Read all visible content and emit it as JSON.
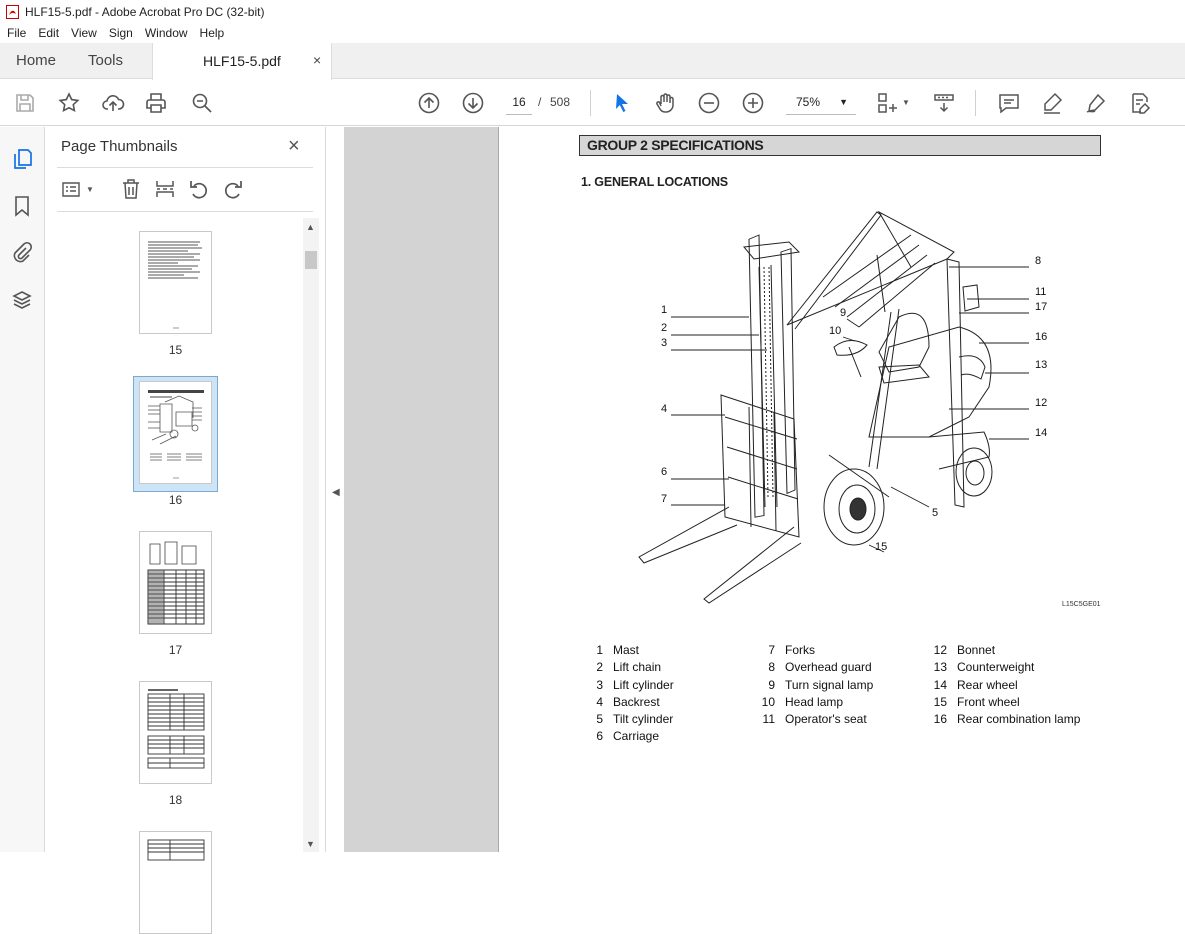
{
  "window": {
    "title": "HLF15-5.pdf - Adobe Acrobat Pro DC (32-bit)"
  },
  "menu": [
    "File",
    "Edit",
    "View",
    "Sign",
    "Window",
    "Help"
  ],
  "tabs": {
    "home": "Home",
    "tools": "Tools",
    "document": "HLF15-5.pdf",
    "close": "×"
  },
  "toolbar": {
    "current_page": "16",
    "separator": "/",
    "total_pages": "508",
    "zoom": "75%"
  },
  "panel": {
    "title": "Page Thumbnails",
    "thumbnails": [
      {
        "page": "15"
      },
      {
        "page": "16",
        "selected": true
      },
      {
        "page": "17"
      },
      {
        "page": "18"
      }
    ]
  },
  "document": {
    "group_title": "GROUP 2  SPECIFICATIONS",
    "section_title": "1. GENERAL LOCATIONS",
    "figure_code": "L15C5GE01",
    "callouts": [
      "1",
      "2",
      "3",
      "4",
      "6",
      "7",
      "9",
      "10",
      "8",
      "11",
      "17",
      "16",
      "13",
      "12",
      "14",
      "5",
      "15"
    ],
    "legend": [
      {
        "num": "1",
        "label": "Mast"
      },
      {
        "num": "2",
        "label": "Lift chain"
      },
      {
        "num": "3",
        "label": "Lift cylinder"
      },
      {
        "num": "4",
        "label": "Backrest"
      },
      {
        "num": "5",
        "label": "Tilt cylinder"
      },
      {
        "num": "6",
        "label": "Carriage"
      },
      {
        "num": "7",
        "label": "Forks"
      },
      {
        "num": "8",
        "label": "Overhead guard"
      },
      {
        "num": "9",
        "label": "Turn signal lamp"
      },
      {
        "num": "10",
        "label": "Head lamp"
      },
      {
        "num": "11",
        "label": "Operator's seat"
      },
      {
        "num": "12",
        "label": "Bonnet"
      },
      {
        "num": "13",
        "label": "Counterweight"
      },
      {
        "num": "14",
        "label": "Rear wheel"
      },
      {
        "num": "15",
        "label": "Front wheel"
      },
      {
        "num": "16",
        "label": "Rear combination lamp"
      }
    ]
  },
  "colors": {
    "accent_blue": "#1473e6",
    "selection": "#cde4f6",
    "viewer_bg": "#d3d3d3"
  }
}
